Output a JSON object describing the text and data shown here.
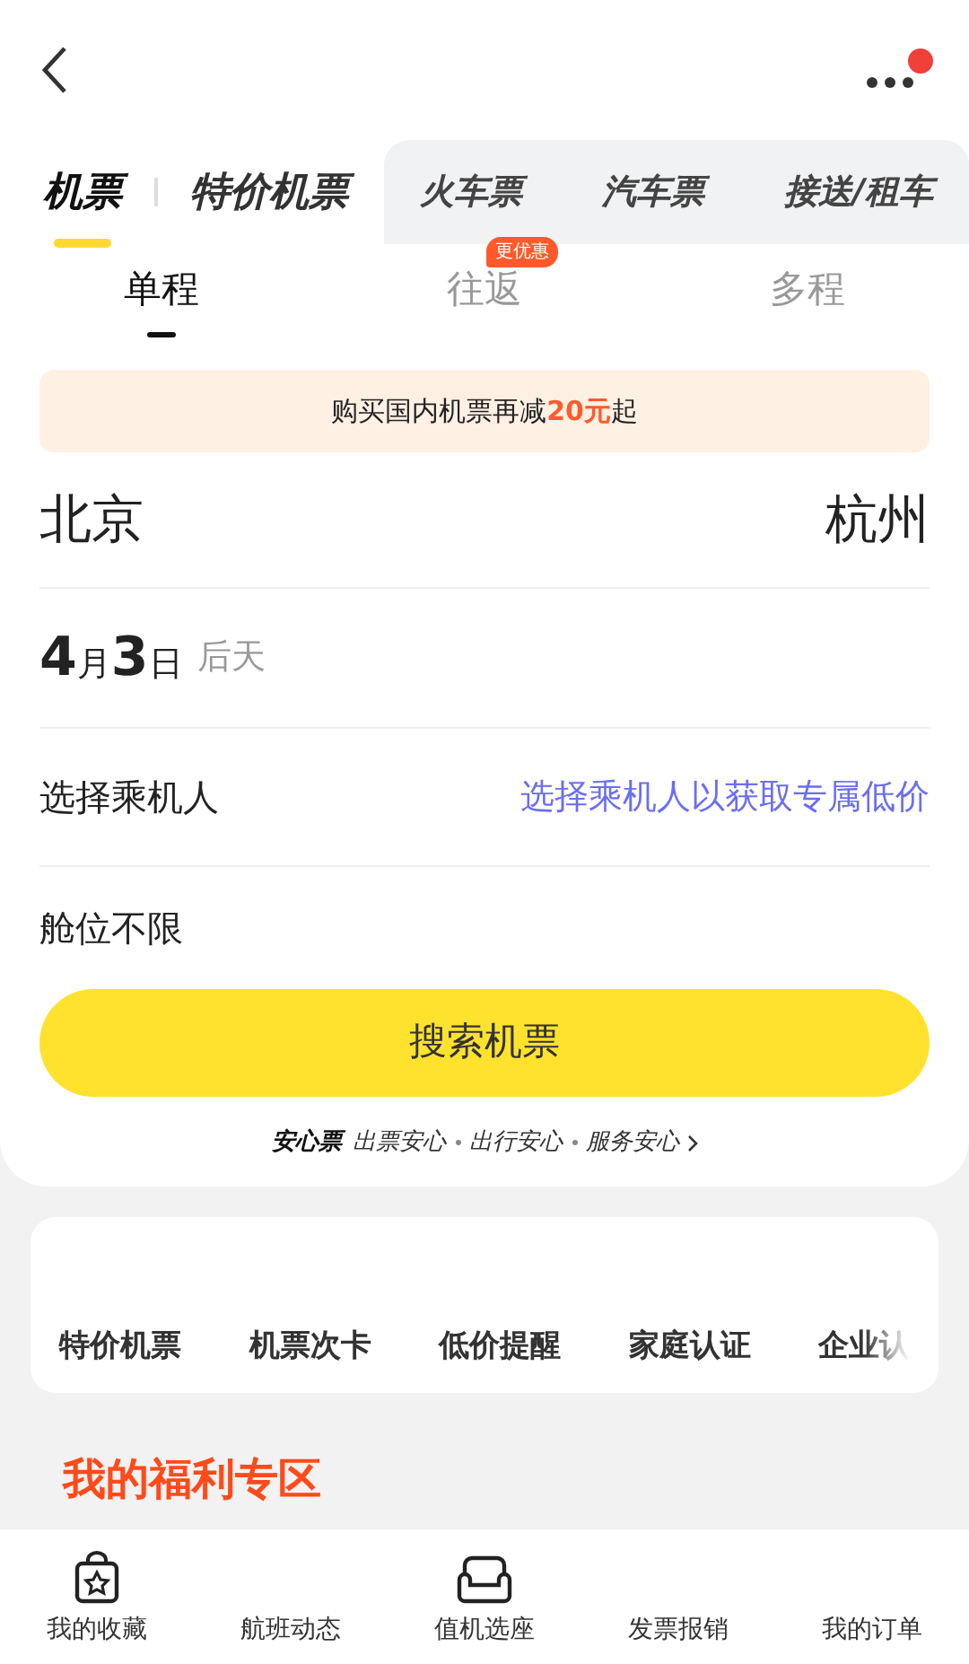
{
  "header": {
    "has_notification": true
  },
  "primary_tabs": [
    {
      "label": "机票",
      "selected": true
    },
    {
      "label": "特价机票",
      "selected": false
    }
  ],
  "other_tabs": [
    {
      "label": "火车票"
    },
    {
      "label": "汽车票"
    },
    {
      "label": "接送/租车"
    }
  ],
  "trip_tabs": [
    {
      "label": "单程",
      "selected": true
    },
    {
      "label": "往返",
      "selected": false,
      "badge": "更优惠"
    },
    {
      "label": "多程",
      "selected": false
    }
  ],
  "promo": {
    "before": "购买国内机票再减",
    "highlight": "20元",
    "after": "起"
  },
  "route": {
    "from": "北京",
    "to": "杭州"
  },
  "date": {
    "month": "4",
    "month_unit": "月",
    "day": "3",
    "day_unit": "日",
    "note": "后天"
  },
  "passenger": {
    "label": "选择乘机人",
    "hint": "选择乘机人以获取专属低价"
  },
  "cabin": "舱位不限",
  "search_button": "搜索机票",
  "assurance": {
    "brand": "安心票",
    "items": [
      "出票安心",
      "出行安心",
      "服务安心"
    ]
  },
  "quick_links": [
    "特价机票",
    "机票次卡",
    "低价提醒",
    "家庭认证",
    "企业认"
  ],
  "welfare_title": "我的福利专区",
  "bottom_nav": [
    {
      "label": "我的收藏",
      "kind": "bag"
    },
    {
      "label": "航班动态",
      "kind": "plain"
    },
    {
      "label": "值机选座",
      "kind": "sofa"
    },
    {
      "label": "发票报销",
      "kind": "plain"
    },
    {
      "label": "我的订单",
      "kind": "plain"
    }
  ]
}
